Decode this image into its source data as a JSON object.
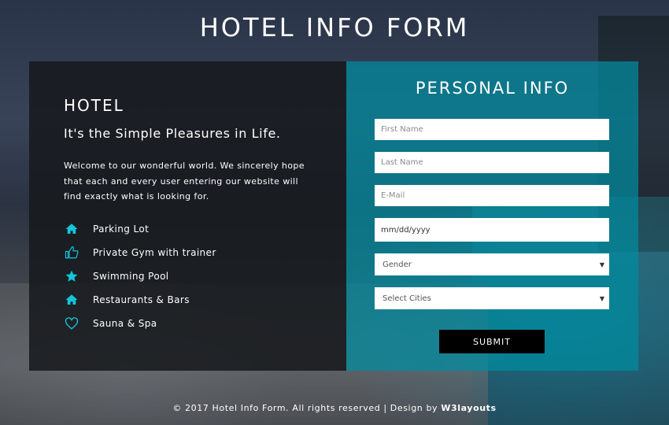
{
  "page": {
    "title": "HOTEL INFO FORM"
  },
  "hotel": {
    "heading": "HOTEL",
    "tagline": "It's the Simple Pleasures in Life.",
    "welcome": "Welcome to our wonderful world. We sincerely hope that each and every user entering our website will find exactly what is looking for.",
    "amenities": [
      {
        "icon": "home-icon",
        "label": "Parking Lot"
      },
      {
        "icon": "thumbs-up-icon",
        "label": "Private Gym with trainer"
      },
      {
        "icon": "star-icon",
        "label": "Swimming Pool"
      },
      {
        "icon": "home-icon",
        "label": "Restaurants & Bars"
      },
      {
        "icon": "heart-icon",
        "label": "Sauna & Spa"
      }
    ]
  },
  "form": {
    "title": "PERSONAL INFO",
    "first_name_placeholder": "First Name",
    "last_name_placeholder": "Last Name",
    "email_placeholder": "E-Mail",
    "date_value": "mm/dd/yyyy",
    "gender_selected": "Gender",
    "city_selected": "Select Cities",
    "submit_label": "SUBMIT"
  },
  "footer": {
    "text": "© 2017 Hotel Info Form. All rights reserved | Design by ",
    "brand": "W3layouts"
  },
  "colors": {
    "accent": "#00bcd4",
    "form_panel": "#008ca0",
    "left_panel": "#16181c",
    "submit_bg": "#000000"
  }
}
